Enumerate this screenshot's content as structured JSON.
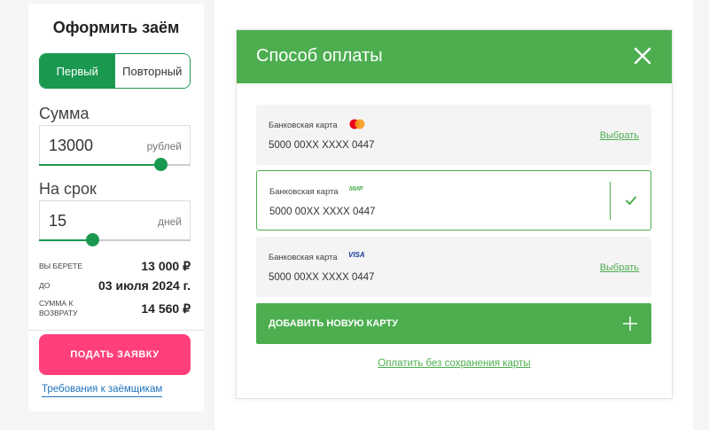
{
  "left": {
    "title": "Оформить заём",
    "segment": {
      "first": "Первый",
      "repeat": "Повторный"
    },
    "amount": {
      "label": "Сумма",
      "value": "13000",
      "unit": "рублей",
      "level": 0.8
    },
    "term": {
      "label": "На срок",
      "value": "15",
      "unit": "дней",
      "level": 0.35
    },
    "summary": [
      {
        "key": "Вы берете",
        "value": "13 000 ₽"
      },
      {
        "key": "До",
        "value": "03 июля 2024 г."
      },
      {
        "key": "Сумма к возврату",
        "value": "14 560 ₽"
      }
    ],
    "apply": "ПОДАТЬ ЗАЯВКУ",
    "requirements": "Требования к заёмщикам"
  },
  "modal": {
    "title": "Способ оплаты",
    "cards": [
      {
        "name": "Банковская карта",
        "brand": "mastercard",
        "number": "5000 00XX XXXX 0447",
        "action": "Выбрать",
        "selected": false
      },
      {
        "name": "Банковская карта",
        "brand": "mir",
        "number": "5000 00XX XXXX 0447",
        "action": "",
        "selected": true
      },
      {
        "name": "Банковская карта",
        "brand": "visa",
        "number": "5000 00XX XXXX 0447",
        "action": "Выбрать",
        "selected": false
      }
    ],
    "brand_labels": {
      "mir": "МИР",
      "visa": "VISA"
    },
    "add_card": "ДОБАВИТЬ НОВУЮ КАРТУ",
    "pay_without_saving": "Оплатить без сохранения карты"
  },
  "colors": {
    "green": "#4cae4f",
    "dark_green": "#1a9850",
    "pink": "#ff3f7b",
    "link_blue": "#1e73be"
  }
}
